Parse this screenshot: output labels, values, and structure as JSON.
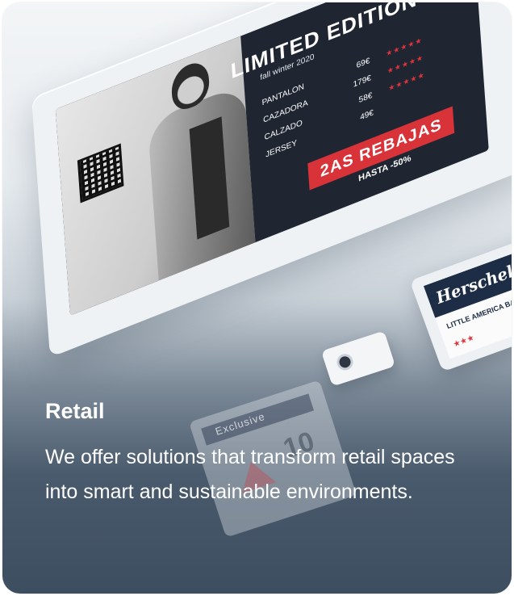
{
  "card": {
    "title": "Retail",
    "description": "We offer solutions that transform retail spaces into smart and sustainable environments."
  },
  "main_screen": {
    "title": "LIMITED EDITION",
    "subtitle": "fall winter 2020",
    "rows": [
      {
        "label": "PANTALON",
        "price": "69€",
        "stars": "★★★★★"
      },
      {
        "label": "CAZADORA",
        "price": "179€",
        "stars": "★★★★★"
      },
      {
        "label": "CALZADO",
        "price": "58€",
        "stars": "★★★★★"
      },
      {
        "label": "JERSEY",
        "price": "49€",
        "stars": ""
      }
    ],
    "banner": "2AS REBAJAS",
    "banner_sub": "HASTA -50%"
  },
  "right_screen": {
    "brand": "Herschel",
    "tagline": "LITTLE AMERICA BACKPACK",
    "stars": "★★★"
  },
  "bottom_label": {
    "word": "Exclusive",
    "digit": "10"
  },
  "colors": {
    "sale_red": "#d9333a",
    "navy": "#1d2d45",
    "text_white": "#ffffff"
  }
}
